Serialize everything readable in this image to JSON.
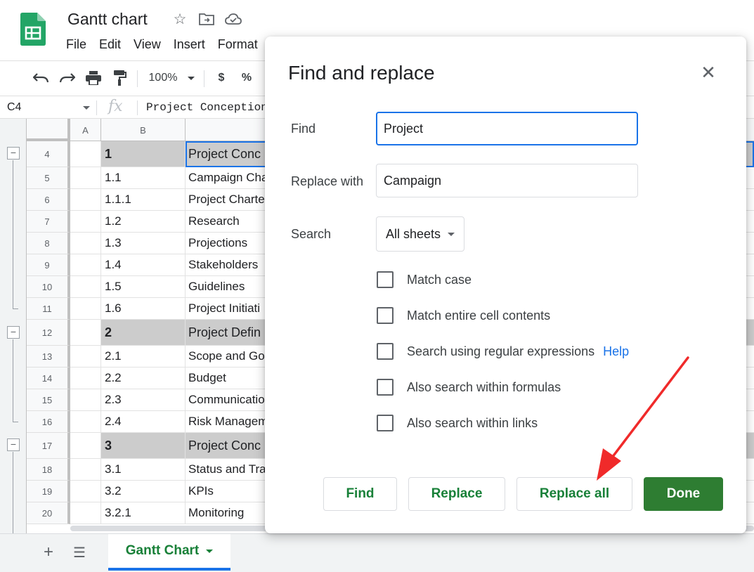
{
  "app": {
    "doc_title": "Gantt chart",
    "menu": [
      "File",
      "Edit",
      "View",
      "Insert",
      "Format"
    ]
  },
  "toolbar": {
    "zoom": "100%",
    "currency": "$",
    "percent": "%"
  },
  "formula_bar": {
    "name_box": "C4",
    "fx": "fx",
    "formula": "Project Conception"
  },
  "grid": {
    "columns": [
      "A",
      "B"
    ],
    "rows": [
      {
        "num": "4",
        "b": "1",
        "c": "Project Conc",
        "section": true
      },
      {
        "num": "5",
        "b": "1.1",
        "c": "Campaign Cha"
      },
      {
        "num": "6",
        "b": "1.1.1",
        "c": "Project Charte"
      },
      {
        "num": "7",
        "b": "1.2",
        "c": "Research"
      },
      {
        "num": "8",
        "b": "1.3",
        "c": "Projections"
      },
      {
        "num": "9",
        "b": "1.4",
        "c": "Stakeholders"
      },
      {
        "num": "10",
        "b": "1.5",
        "c": "Guidelines"
      },
      {
        "num": "11",
        "b": "1.6",
        "c": "Project Initiati"
      },
      {
        "num": "12",
        "b": "2",
        "c": "Project Defin",
        "section": true
      },
      {
        "num": "13",
        "b": "2.1",
        "c": "Scope and Go"
      },
      {
        "num": "14",
        "b": "2.2",
        "c": "Budget"
      },
      {
        "num": "15",
        "b": "2.3",
        "c": "Communicatio"
      },
      {
        "num": "16",
        "b": "2.4",
        "c": "Risk Managem"
      },
      {
        "num": "17",
        "b": "3",
        "c": "Project Conc",
        "section": true
      },
      {
        "num": "18",
        "b": "3.1",
        "c": "Status and Tra"
      },
      {
        "num": "19",
        "b": "3.2",
        "c": "KPIs"
      },
      {
        "num": "20",
        "b": "3.2.1",
        "c": "Monitoring"
      }
    ]
  },
  "sheets": {
    "active_tab": "Gantt Chart"
  },
  "dialog": {
    "title": "Find and replace",
    "find_label": "Find",
    "find_value": "Project",
    "replace_label": "Replace with",
    "replace_value": "Campaign",
    "search_label": "Search",
    "search_value": "All sheets",
    "options": [
      {
        "label": "Match case",
        "checked": false
      },
      {
        "label": "Match entire cell contents",
        "checked": false
      },
      {
        "label": "Search using regular expressions",
        "checked": false,
        "link": "Help"
      },
      {
        "label": "Also search within formulas",
        "checked": false
      },
      {
        "label": "Also search within links",
        "checked": false
      }
    ],
    "buttons": {
      "find": "Find",
      "replace": "Replace",
      "replace_all": "Replace all",
      "done": "Done"
    }
  },
  "colors": {
    "accent_blue": "#1a73e8",
    "green": "#188038",
    "done_button": "#2e7d32",
    "annotation_arrow": "#f02a2a"
  }
}
